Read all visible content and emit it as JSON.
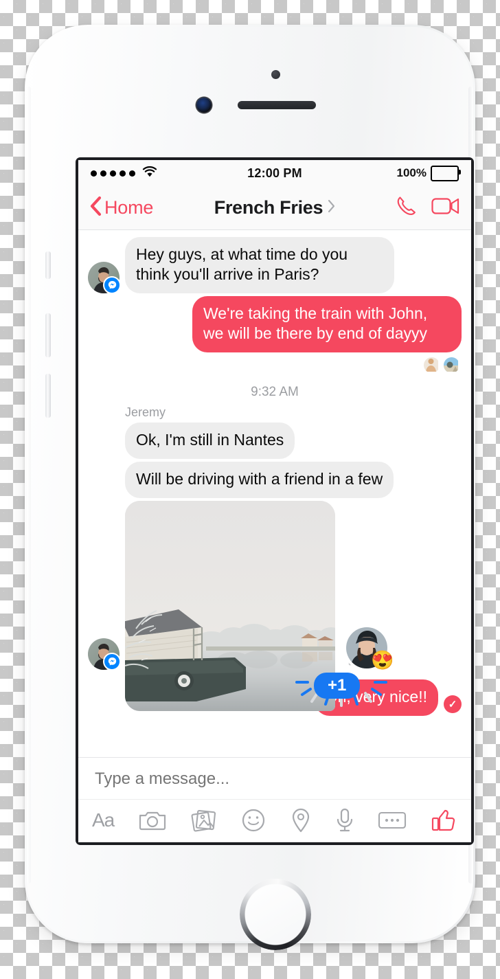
{
  "device": {
    "name": "white-iphone",
    "home_button": "home-button"
  },
  "status_bar": {
    "signal_dots": 5,
    "wifi_icon": "wifi-icon",
    "time": "12:00 PM",
    "battery_percent": "100%",
    "battery_icon": "battery-full-icon"
  },
  "nav": {
    "back_icon": "chevron-left-icon",
    "back_label": "Home",
    "title": "French Fries",
    "title_chevron": "chevron-right-icon",
    "voice_call_icon": "phone-icon",
    "video_call_icon": "video-camera-icon",
    "accent_color": "#F5485F"
  },
  "thread": {
    "messages": [
      {
        "id": "m1",
        "direction": "in",
        "text": "Hey guys, at what time do you think you'll arrive in Paris?",
        "avatar": "bearded-man-avatar",
        "badge": "messenger-badge"
      },
      {
        "id": "m2",
        "direction": "out",
        "text": "We're taking the train with John, we will be there by end of dayyy"
      }
    ],
    "read_receipts": [
      "receipt-avatar-1",
      "receipt-avatar-2"
    ],
    "time_separator": "9:32 AM",
    "sender_name": "Jeremy",
    "messages_2": [
      {
        "id": "m3",
        "direction": "in",
        "text": "Ok, I'm still in Nantes"
      },
      {
        "id": "m4",
        "direction": "in",
        "text": "Will be driving with a friend in a few"
      }
    ],
    "photo_message": {
      "id": "m5",
      "alt": "winter-river-boathouse-photo",
      "share_icon": "share-upload-icon",
      "avatar": "bearded-man-avatar",
      "badge": "messenger-badge",
      "reaction": {
        "avatar": "woman-beanie-avatar",
        "emoji": "😍",
        "emoji_name": "heart-eyes-emoji",
        "count_label": "+1",
        "count_color": "#1778F2"
      }
    },
    "last_message": {
      "id": "m6",
      "direction": "out",
      "text": "Oh, very nice!!",
      "delivered_icon": "delivered-check-icon"
    },
    "bubble_in_color": "#ededed",
    "bubble_out_color": "#F5485F"
  },
  "composer": {
    "placeholder": "Type a message...",
    "value": "",
    "tools": [
      {
        "name": "text-format-icon",
        "label": "Aa"
      },
      {
        "name": "camera-icon"
      },
      {
        "name": "photo-library-icon"
      },
      {
        "name": "sticker-smiley-icon"
      },
      {
        "name": "location-pin-icon"
      },
      {
        "name": "microphone-icon"
      },
      {
        "name": "more-options-icon"
      },
      {
        "name": "thumbs-up-icon"
      }
    ]
  }
}
